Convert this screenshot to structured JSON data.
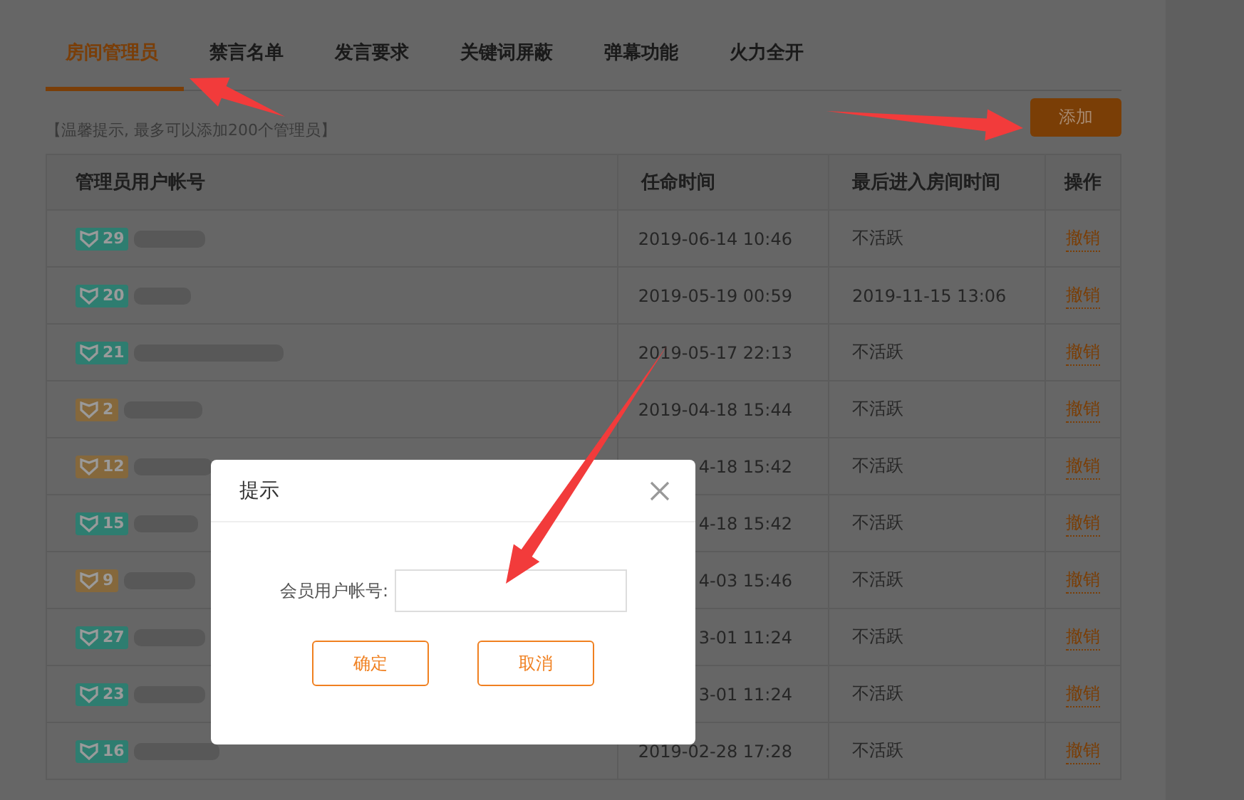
{
  "tabs": [
    {
      "label": "房间管理员",
      "selected": true
    },
    {
      "label": "禁言名单",
      "selected": false
    },
    {
      "label": "发言要求",
      "selected": false
    },
    {
      "label": "关键词屏蔽",
      "selected": false
    },
    {
      "label": "弹幕功能",
      "selected": false
    },
    {
      "label": "火力全开",
      "selected": false
    }
  ],
  "hint": "【温馨提示, 最多可以添加200个管理员】",
  "add_button": "添加",
  "table": {
    "columns": [
      "管理员用户帐号",
      "任命时间",
      "最后进入房间时间",
      "操作"
    ],
    "rows": [
      {
        "badge": "29",
        "color": "#2e7d70",
        "appointed": "2019-06-14 10:46",
        "last_entry": "不活跃",
        "action": "撤销"
      },
      {
        "badge": "20",
        "color": "#2e7d70",
        "appointed": "2019-05-19 00:59",
        "last_entry": "2019-11-15 13:06",
        "action": "撤销"
      },
      {
        "badge": "21",
        "color": "#2e7d70",
        "appointed": "2019-05-17 22:13",
        "last_entry": "不活跃",
        "action": "撤销"
      },
      {
        "badge": "2",
        "color": "#85683c",
        "appointed": "2019-04-18 15:44",
        "last_entry": "不活跃",
        "action": "撤销"
      },
      {
        "badge": "12",
        "color": "#85683c",
        "appointed": "4-18 15:42",
        "last_entry": "不活跃",
        "action": "撤销"
      },
      {
        "badge": "15",
        "color": "#2e7d70",
        "appointed": "4-18 15:42",
        "last_entry": "不活跃",
        "action": "撤销"
      },
      {
        "badge": "9",
        "color": "#85683c",
        "appointed": "4-03 15:46",
        "last_entry": "不活跃",
        "action": "撤销"
      },
      {
        "badge": "27",
        "color": "#2e7d70",
        "appointed": "3-01 11:24",
        "last_entry": "不活跃",
        "action": "撤销"
      },
      {
        "badge": "23",
        "color": "#2e7d70",
        "appointed": "3-01 11:24",
        "last_entry": "不活跃",
        "action": "撤销"
      },
      {
        "badge": "16",
        "color": "#2e7d70",
        "appointed": "2019-02-28 17:28",
        "last_entry": "不活跃",
        "action": "撤销"
      }
    ]
  },
  "dialog": {
    "title": "提示",
    "field_label": "会员用户帐号:",
    "buttons": [
      "确定",
      "取消"
    ]
  }
}
